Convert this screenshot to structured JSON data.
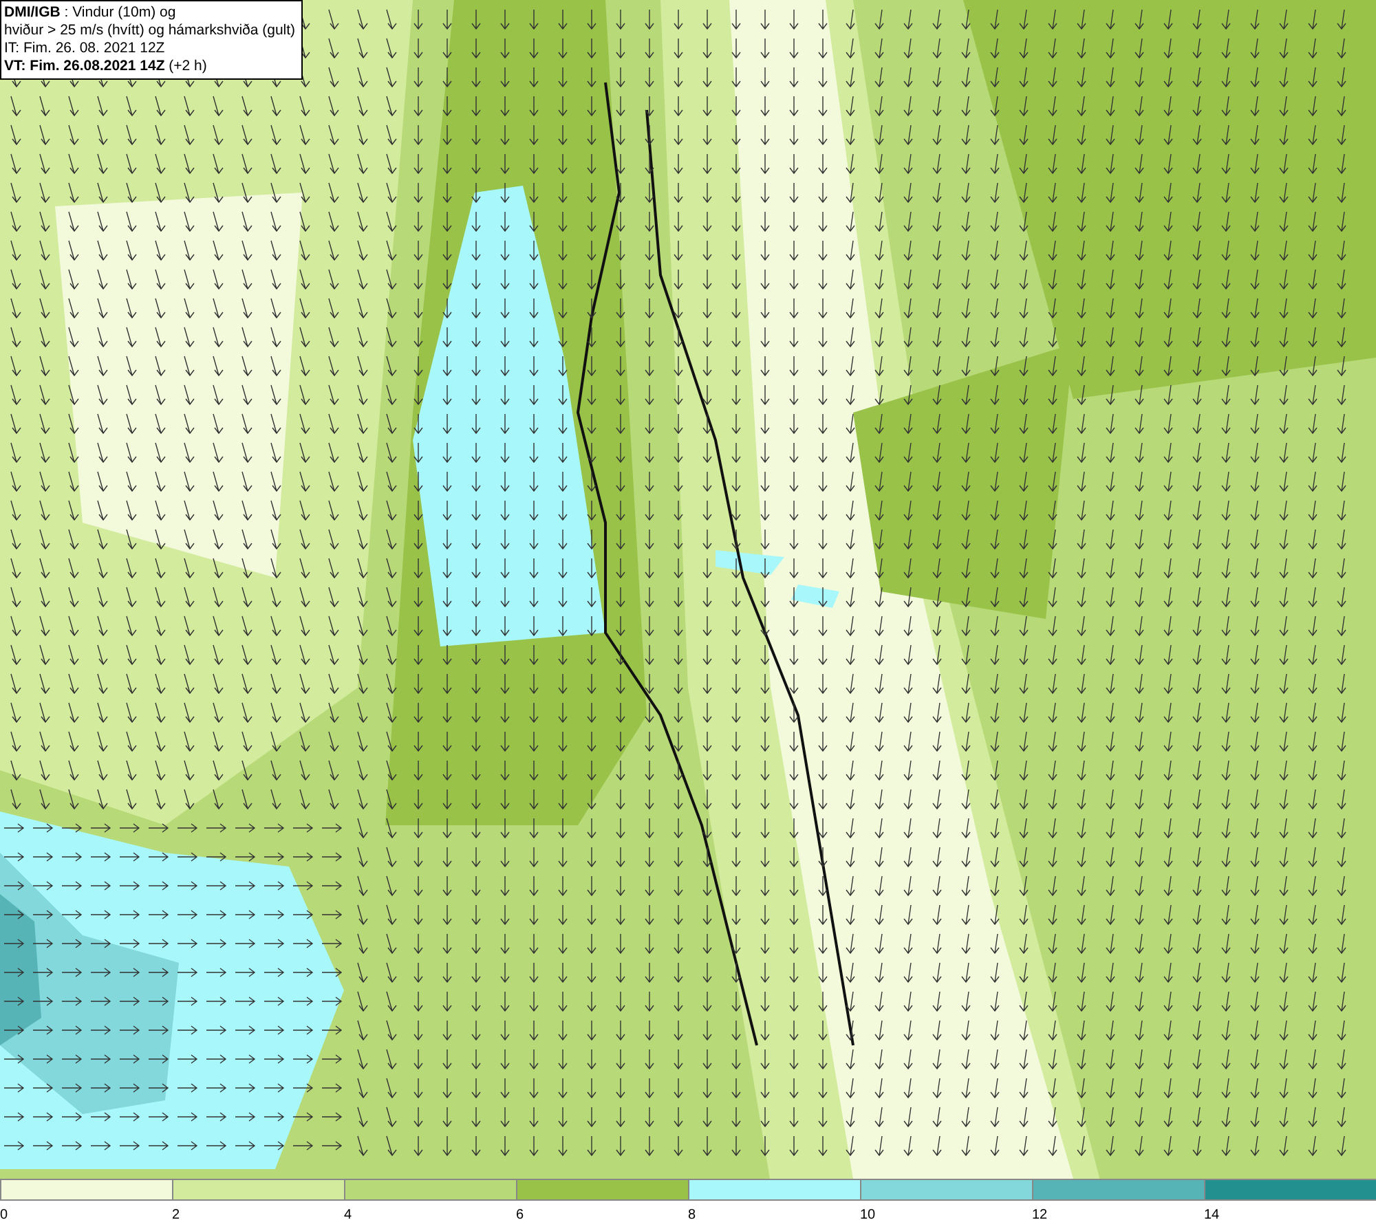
{
  "header": {
    "lines": [
      "**DMI/IGB** : Vindur (10m) og",
      "hviður > 25 m/s (hvítt) og hámarkshviða (gult)",
      "IT: Fim. 26. 08. 2021 12Z",
      "**VT: Fim. 26.08.2021 14Z** (+2 h)"
    ]
  },
  "legend": {
    "segments": [
      {
        "color": "#f3fadc"
      },
      {
        "color": "#d3eb9c"
      },
      {
        "color": "#b7d977"
      },
      {
        "color": "#99c249"
      },
      {
        "color": "#a8f8fb"
      },
      {
        "color": "#82d8da"
      },
      {
        "color": "#56b4b6"
      },
      {
        "color": "#21908f"
      }
    ],
    "labels": [
      "0",
      "2",
      "4",
      "6",
      "8",
      "10",
      "12",
      "14"
    ]
  }
}
